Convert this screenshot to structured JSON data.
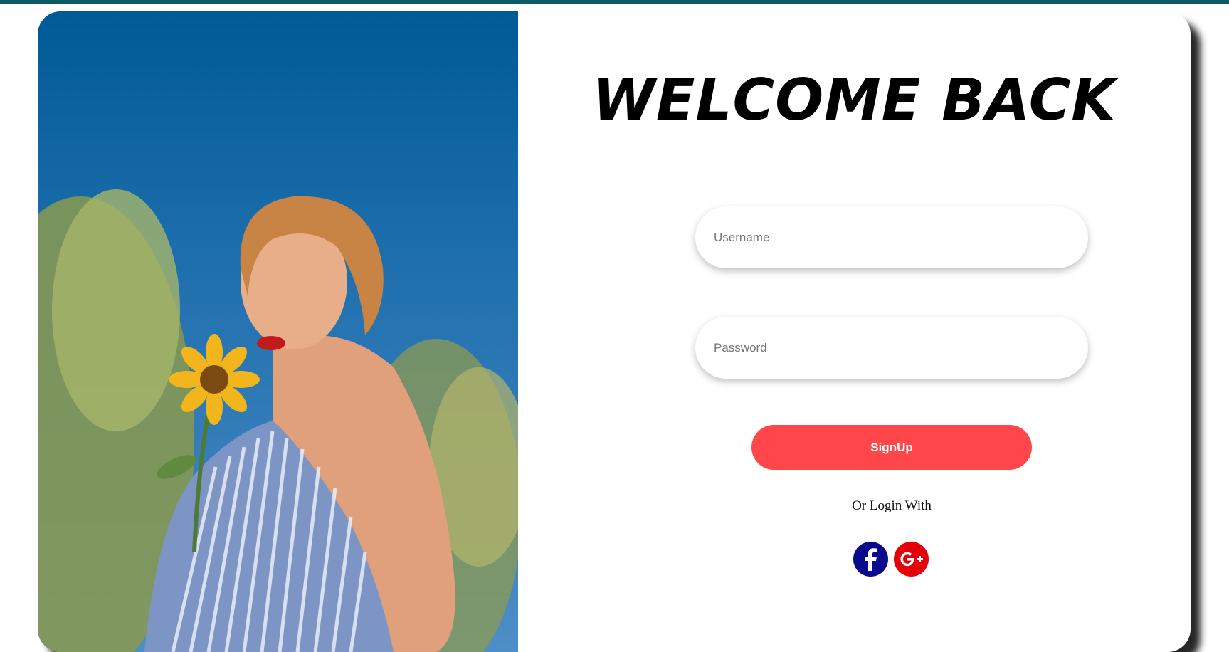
{
  "title": "WELCOME BACK",
  "form": {
    "username_placeholder": "Username",
    "username_value": "",
    "password_placeholder": "Password",
    "password_value": "",
    "signup_label": "SignUp",
    "or_login_label": "Or Login With"
  },
  "social": [
    {
      "name": "facebook-icon",
      "color": "#0a0a8c"
    },
    {
      "name": "google-plus-icon",
      "color": "#e6000a"
    }
  ],
  "colors": {
    "accent": "#ff474b",
    "top_bar": "#0c5a63"
  }
}
